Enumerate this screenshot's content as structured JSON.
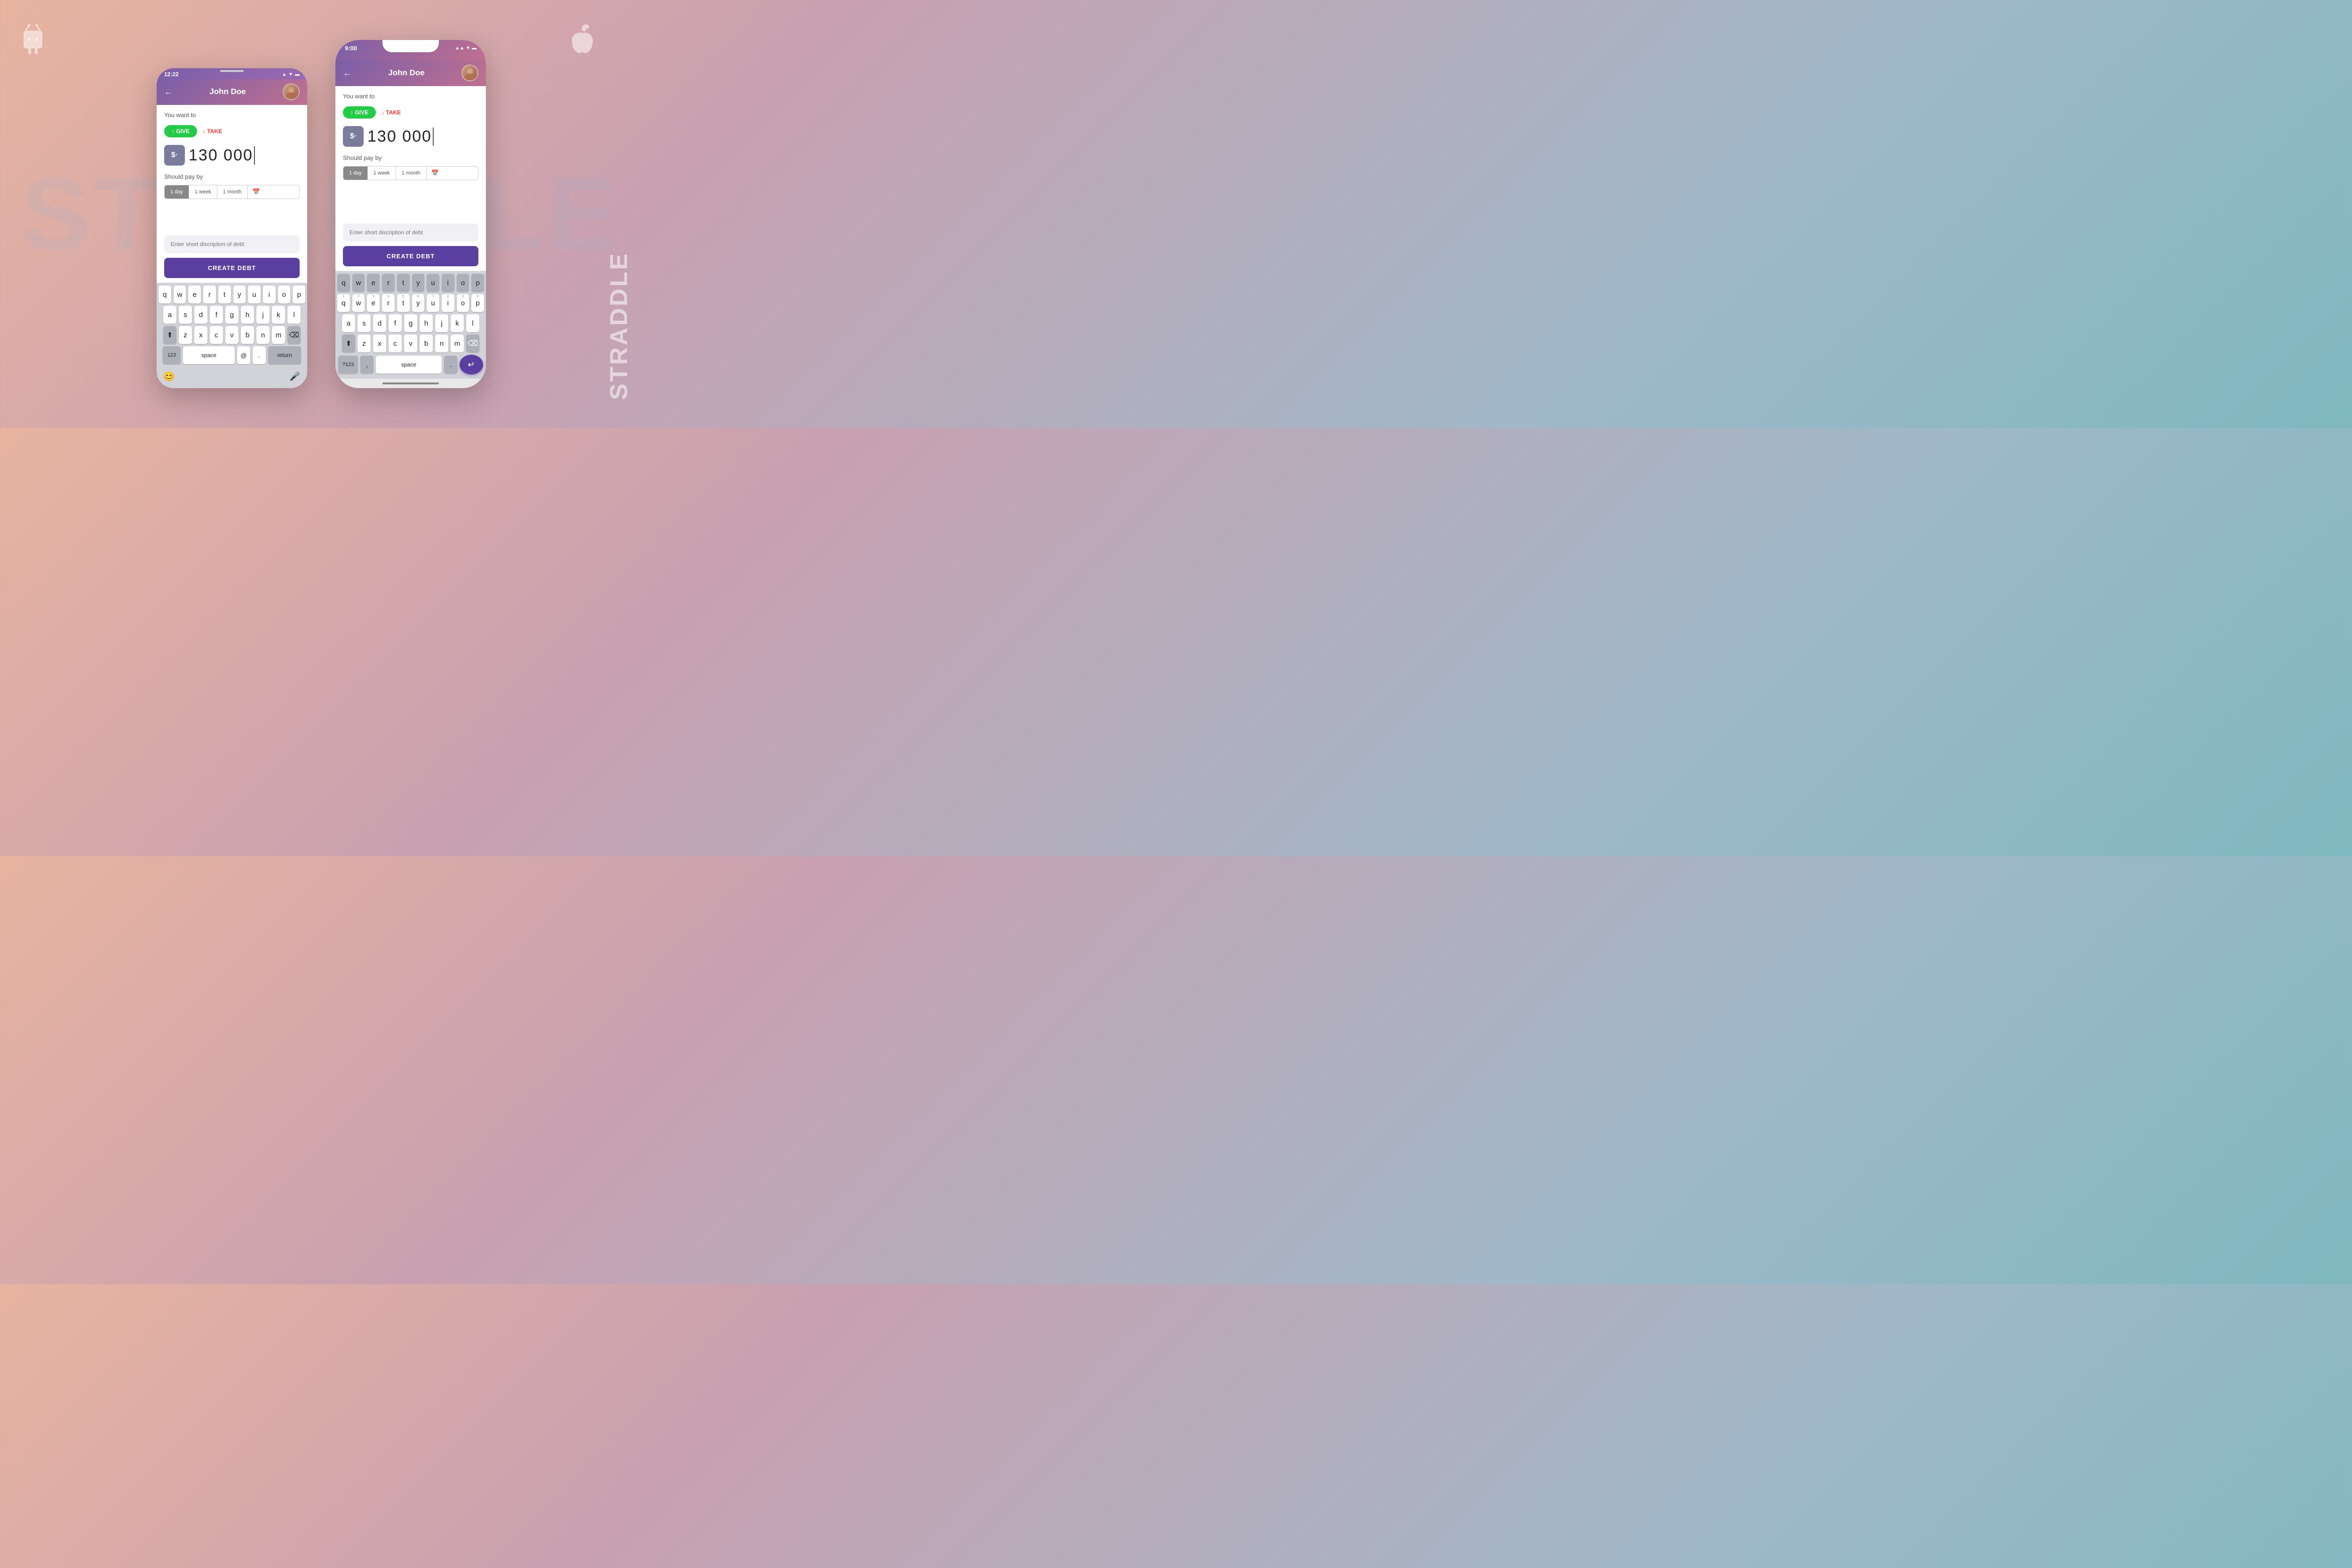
{
  "background": {
    "text": "STRADDLE",
    "straddle_vertical": "STRADDLE"
  },
  "icons": {
    "android": "🤖",
    "apple": ""
  },
  "phone_android": {
    "status_bar": {
      "time": "12:22",
      "signal": "▲",
      "wifi": "▼",
      "battery": "▬"
    },
    "header": {
      "back": "←",
      "title": "John Doe",
      "avatar_emoji": "👨"
    },
    "you_want_to": "You want to",
    "give_label": "↑ GIVE",
    "take_label": "↓ TAKE",
    "amount": "130 000",
    "currency_symbol": "$·",
    "should_pay_by": "Should pay by",
    "time_options": [
      "1 day",
      "1 week",
      "1 month",
      "📅"
    ],
    "active_option": 0,
    "description_placeholder": "Enter short discription of debt",
    "create_btn": "CREATE DEBT",
    "keyboard": {
      "row1": [
        "q",
        "w",
        "e",
        "r",
        "t",
        "y",
        "u",
        "i",
        "o",
        "p"
      ],
      "row2": [
        "a",
        "s",
        "d",
        "f",
        "g",
        "h",
        "j",
        "k",
        "l"
      ],
      "row3": [
        "z",
        "x",
        "c",
        "v",
        "b",
        "n",
        "m"
      ],
      "bottom": [
        "123",
        "space",
        "@",
        ".",
        "return"
      ]
    }
  },
  "phone_ios": {
    "status_bar": {
      "time": "9:00",
      "signal": "▲▲",
      "battery": "▬"
    },
    "header": {
      "back": "←",
      "title": "John Doe",
      "avatar_emoji": "👨"
    },
    "you_want_to": "You want to",
    "give_label": "↑ GIVE",
    "take_label": "↓ TAKE",
    "amount": "130 000",
    "currency_symbol": "$·",
    "should_pay_by": "Should pay by",
    "time_options": [
      "1 day",
      "1 week",
      "1 month",
      "📅"
    ],
    "active_option": 0,
    "description_placeholder": "Enter short discription of debt",
    "create_btn": "CREATE DEBT",
    "keyboard": {
      "row0": [
        "1",
        "2",
        "3",
        "4",
        "5",
        "6",
        "7",
        "8",
        "9",
        "0"
      ],
      "row1": [
        "q",
        "w",
        "e",
        "r",
        "t",
        "y",
        "u",
        "i",
        "o",
        "p"
      ],
      "row2": [
        "a",
        "s",
        "d",
        "f",
        "g",
        "h",
        "j",
        "k",
        "l"
      ],
      "row3": [
        "z",
        "x",
        "c",
        "v",
        "b",
        "n",
        "m"
      ],
      "bottom": [
        "?123",
        ",",
        "space",
        ".",
        "↵"
      ]
    }
  }
}
